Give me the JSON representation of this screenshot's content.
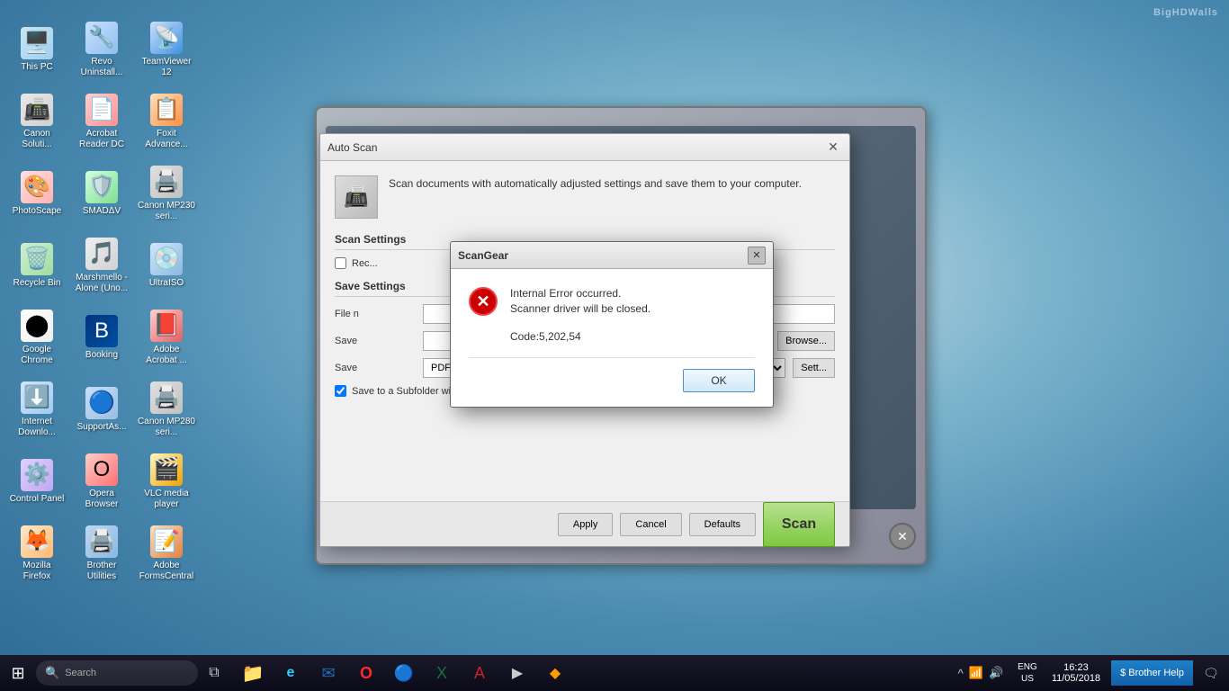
{
  "desktop": {
    "watermark": "BigHDWalls",
    "background_desc": "Blue teddy bear wallpaper"
  },
  "icons": [
    {
      "id": "this-pc",
      "label": "This PC",
      "icon": "🖥️",
      "style_class": "icon-thispc"
    },
    {
      "id": "canon-solutions",
      "label": "Canon Soluti...",
      "icon": "📠",
      "style_class": "icon-canon"
    },
    {
      "id": "photoscape",
      "label": "PhotoScape",
      "icon": "🎨",
      "style_class": "icon-photoscape"
    },
    {
      "id": "recycle-bin",
      "label": "Recycle Bin",
      "icon": "🗑️",
      "style_class": "icon-recycle"
    },
    {
      "id": "google-chrome",
      "label": "Google Chrome",
      "icon": "⬤",
      "style_class": "icon-chrome"
    },
    {
      "id": "internet-download",
      "label": "Internet Downlo...",
      "icon": "⬇️",
      "style_class": "icon-idm"
    },
    {
      "id": "control-panel",
      "label": "Control Panel",
      "icon": "⚙️",
      "style_class": "icon-cpanel"
    },
    {
      "id": "mozilla-firefox",
      "label": "Mozilla Firefox",
      "icon": "🦊",
      "style_class": "icon-firefox"
    },
    {
      "id": "revo-uninstall",
      "label": "Revo Uninstall...",
      "icon": "🔧",
      "style_class": "icon-revo"
    },
    {
      "id": "acrobat-reader",
      "label": "Acrobat Reader DC",
      "icon": "📄",
      "style_class": "icon-acrobat"
    },
    {
      "id": "smadav",
      "label": "SMADΔV",
      "icon": "🛡️",
      "style_class": "icon-smadav"
    },
    {
      "id": "marshmello",
      "label": "Marshmello - Alone (Uno...",
      "icon": "🎵",
      "style_class": "icon-marshmello"
    },
    {
      "id": "booking",
      "label": "Booking",
      "icon": "B",
      "style_class": "icon-booking"
    },
    {
      "id": "supportas",
      "label": "SupportAs...",
      "icon": "🔵",
      "style_class": "icon-supportas"
    },
    {
      "id": "opera-browser",
      "label": "Opera Browser",
      "icon": "O",
      "style_class": "icon-opera"
    },
    {
      "id": "brother-utilities",
      "label": "Brother Utilities",
      "icon": "🖨️",
      "style_class": "icon-brother"
    },
    {
      "id": "teamviewer",
      "label": "TeamViewer 12",
      "icon": "📡",
      "style_class": "icon-teamviewer"
    },
    {
      "id": "foxit-advanced",
      "label": "Foxit Advance...",
      "icon": "📋",
      "style_class": "icon-foxit"
    },
    {
      "id": "canon-mp230",
      "label": "Canon MP230 seri...",
      "icon": "🖨️",
      "style_class": "icon-canonmp230"
    },
    {
      "id": "ultraiso",
      "label": "UltraISO",
      "icon": "💿",
      "style_class": "icon-ultraiso"
    },
    {
      "id": "adobe-acrobat2",
      "label": "Adobe Acrobat ...",
      "icon": "📕",
      "style_class": "icon-adobeacrobat"
    },
    {
      "id": "canon-mp280",
      "label": "Canon MP280 seri...",
      "icon": "🖨️",
      "style_class": "icon-canonmp280"
    },
    {
      "id": "vlc",
      "label": "VLC media player",
      "icon": "🎬",
      "style_class": "icon-vlc"
    },
    {
      "id": "adobe-forms",
      "label": "Adobe FormsCentral",
      "icon": "📝",
      "style_class": "icon-adobeforms"
    }
  ],
  "autoscan_window": {
    "title": "Auto Scan",
    "description": "Scan documents with automatically adjusted settings and save them to your computer.",
    "scan_settings_label": "Scan Settings",
    "recommended_checkbox_label": "Rec...",
    "save_settings_label": "Save Settings",
    "file_name_label": "File n",
    "save_in_label": "Save",
    "save_to_label": "Save",
    "subfolder_checkbox_label": "Save to a Subfolder with Current Date",
    "apply_btn": "Apply",
    "cancel_btn": "Cancel",
    "defaults_btn": "Defaults",
    "scan_btn": "Scan"
  },
  "scangear_dialog": {
    "title": "ScanGear",
    "error_line1": "Internal Error occurred.",
    "error_line2": "Scanner driver will be closed.",
    "error_code": "Code:5,202,54",
    "ok_btn": "OK"
  },
  "taskbar": {
    "search_placeholder": "Search",
    "apps": [
      {
        "id": "file-explorer",
        "icon": "📁"
      },
      {
        "id": "edge-browser",
        "icon": "🌐"
      },
      {
        "id": "outlook",
        "icon": "📧"
      },
      {
        "id": "opera",
        "icon": "O"
      },
      {
        "id": "google-tb",
        "icon": "🔵"
      },
      {
        "id": "excel",
        "icon": "📊"
      },
      {
        "id": "acrobat-tb",
        "icon": "📄"
      },
      {
        "id": "windows-media",
        "icon": "⊞"
      },
      {
        "id": "unknown-app",
        "icon": "🔶"
      }
    ],
    "sys_tray": {
      "icons": [
        "👤",
        "^",
        "📶",
        "🔊"
      ]
    },
    "clock": {
      "time": "16:23",
      "date": "11/05/2018"
    },
    "lang": {
      "line1": "ENG",
      "line2": "US"
    },
    "brother_help": "$ Brother Help"
  }
}
